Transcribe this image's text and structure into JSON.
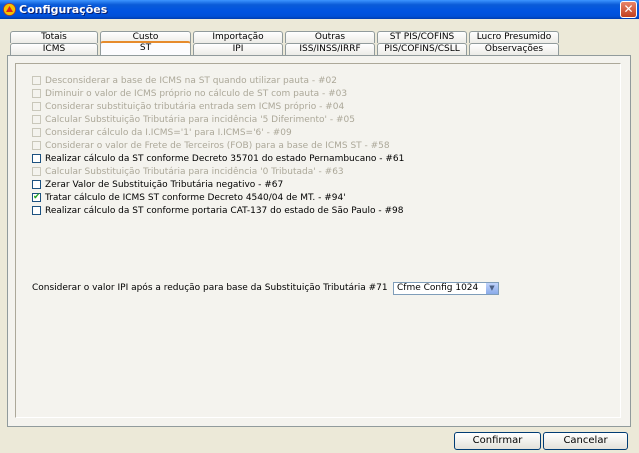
{
  "window": {
    "title": "Configurações"
  },
  "tabs_top": [
    {
      "label": "Totais"
    },
    {
      "label": "Custo"
    },
    {
      "label": "Importação"
    },
    {
      "label": "Outras"
    },
    {
      "label": "ST PIS/COFINS"
    },
    {
      "label": "Lucro Presumido"
    }
  ],
  "tabs_bottom": [
    {
      "label": "ICMS"
    },
    {
      "label": "ST"
    },
    {
      "label": "IPI"
    },
    {
      "label": "ISS/INSS/IRRF"
    },
    {
      "label": "PIS/COFINS/CSLL"
    },
    {
      "label": "Observações"
    }
  ],
  "selected_tab": "ST",
  "options": [
    {
      "label": "Desconsiderar a base de ICMS na ST quando utilizar pauta - #02",
      "checked": false,
      "enabled": false
    },
    {
      "label": "Diminuir o valor de ICMS próprio no cálculo de ST com pauta - #03",
      "checked": false,
      "enabled": false
    },
    {
      "label": "Considerar substituição tributária entrada sem ICMS próprio - #04",
      "checked": false,
      "enabled": false
    },
    {
      "label": "Calcular Substituição Tributária para incidência '5 Diferimento' - #05",
      "checked": false,
      "enabled": false
    },
    {
      "label": "Considerar cálculo da I.ICMS='1' para I.ICMS='6' - #09",
      "checked": false,
      "enabled": false
    },
    {
      "label": "Considerar o valor de Frete de Terceiros (FOB) para a base de ICMS ST - #58",
      "checked": false,
      "enabled": false
    },
    {
      "label": "Realizar cálculo da ST conforme Decreto 35701 do estado Pernambucano - #61",
      "checked": false,
      "enabled": true
    },
    {
      "label": "Calcular Substituição Tributária para incidência '0 Tributada' - #63",
      "checked": false,
      "enabled": false
    },
    {
      "label": "Zerar Valor de Substituição Tributária negativo - #67",
      "checked": false,
      "enabled": true
    },
    {
      "label": "Tratar cálculo de ICMS ST conforme Decreto 4540/04 de MT. - #94'",
      "checked": true,
      "enabled": true
    },
    {
      "label": "Realizar cálculo da ST conforme portaria CAT-137 do estado de São Paulo - #98",
      "checked": false,
      "enabled": true
    }
  ],
  "ipi": {
    "label": "Considerar o valor IPI após a redução para base da Substituição Tributária #71",
    "selected": "Cfme Config 1024"
  },
  "buttons": {
    "confirm": "Confirmar",
    "cancel": "Cancelar"
  }
}
